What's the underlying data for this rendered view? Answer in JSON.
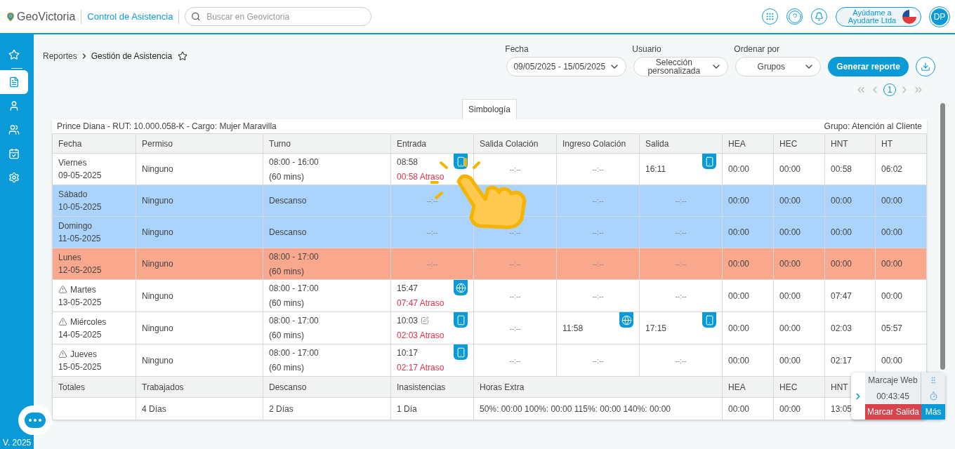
{
  "header": {
    "brand": "GeoVictoria",
    "module": "Control de Asistencia",
    "search": {
      "placeholder": "Buscar en Geovictoria"
    },
    "company": "Ayúdame a Ayudarte Ltda",
    "avatar": "DP"
  },
  "sidebar": {
    "items": [
      {
        "kind": "star",
        "selected": false
      },
      {
        "kind": "report",
        "selected": true
      },
      {
        "kind": "user",
        "selected": false
      },
      {
        "kind": "users",
        "selected": false
      },
      {
        "kind": "calendar",
        "selected": false
      },
      {
        "kind": "settings",
        "selected": false
      }
    ],
    "version": "V. 2025"
  },
  "breadcrumb": [
    "Reportes",
    "Gestión de Asistencia"
  ],
  "filters": [
    {
      "label": "Fecha",
      "value": "09/05/2025 - 15/05/2025"
    },
    {
      "label": "Usuario",
      "value": "Selección personalizada"
    },
    {
      "label": "Ordenar por",
      "value": "Grupos"
    }
  ],
  "generate_button": "Generar reporte",
  "pagination": {
    "current": "1"
  },
  "symbology_tab": "Simbología",
  "report": {
    "employee": "Prince Diana - RUT: 10.000.058-K - Cargo: Mujer Maravilla",
    "group": "Grupo: Atención al Cliente",
    "columns": [
      "Fecha",
      "Permiso",
      "Turno",
      "Entrada",
      "Salida Colación",
      "Ingreso Colación",
      "Salida",
      "HEA",
      "HEC",
      "HNT",
      "HT"
    ],
    "rows": [
      {
        "color": "#ffffff",
        "warning": false,
        "day": "Viernes",
        "date": "09-05-2025",
        "permiso": "Ninguno",
        "turno": "08:00 - 16:00",
        "turno_break": "(60 mins)",
        "entrada": {
          "time": "08:58",
          "late": "00:58 Atraso",
          "kind": "mobile",
          "edited": false
        },
        "salida_colacion": {
          "time": "--:--"
        },
        "ingreso_colacion": {
          "time": "--:--"
        },
        "salida": {
          "time": "16:11",
          "kind": "mobile"
        },
        "hea": "00:00",
        "hec": "00:00",
        "hnt": "00:58",
        "ht": "06:02"
      },
      {
        "color": "#aad4fb",
        "warning": false,
        "day": "Sábado",
        "date": "10-05-2025",
        "permiso": "Ninguno",
        "turno": "Descanso",
        "entrada": {
          "time": "--:--"
        },
        "ingreso_colacion": {
          "time": "--:--"
        },
        "salida": {
          "time": "--:--"
        },
        "hea": "00:00",
        "hec": "00:00",
        "hnt": "00:00",
        "ht": "00:00"
      },
      {
        "color": "#aad4fb",
        "warning": false,
        "day": "Domingo",
        "date": "11-05-2025",
        "permiso": "Ninguno",
        "turno": "Descanso",
        "entrada": {
          "time": "--:--"
        },
        "salida_colacion": {
          "time": "--:--"
        },
        "ingreso_colacion": {
          "time": "--:--"
        },
        "salida": {
          "time": "--:--"
        },
        "hea": "00:00",
        "hec": "00:00",
        "hnt": "00:00",
        "ht": "00:00"
      },
      {
        "color": "#f9a88e",
        "warning": false,
        "day": "Lunes",
        "date": "12-05-2025",
        "permiso": "Ninguno",
        "turno": "08:00 - 17:00",
        "turno_break": "(60 mins)",
        "entrada": {
          "time": "--:--"
        },
        "salida_colacion": {
          "time": "--:--"
        },
        "ingreso_colacion": {
          "time": "--:--"
        },
        "salida": {
          "time": "--:--"
        },
        "hea": "00:00",
        "hec": "00:00",
        "hnt": "00:00",
        "ht": "00:00"
      },
      {
        "color": "#ffffff",
        "warning": true,
        "day": "Martes",
        "date": "13-05-2025",
        "permiso": "Ninguno",
        "turno": "08:00 - 17:00",
        "turno_break": "(60 mins)",
        "entrada": {
          "time": "15:47",
          "late": "07:47 Atraso",
          "kind": "web",
          "edited": false
        },
        "salida_colacion": {
          "time": "--:--"
        },
        "ingreso_colacion": {
          "time": "--:--"
        },
        "salida": {
          "time": "--:--"
        },
        "hea": "00:00",
        "hec": "00:00",
        "hnt": "07:47",
        "ht": "00:00"
      },
      {
        "color": "#ffffff",
        "warning": true,
        "day": "Miércoles",
        "date": "14-05-2025",
        "permiso": "Ninguno",
        "turno": "08:00 - 17:00",
        "turno_break": "(60 mins)",
        "entrada": {
          "time": "10:03",
          "late": "02:03 Atraso",
          "kind": "mobile",
          "edited": true
        },
        "salida_colacion": {
          "time": "--:--"
        },
        "ingreso_colacion": {
          "time": "11:58",
          "kind": "web"
        },
        "salida": {
          "time": "17:15",
          "kind": "mobile"
        },
        "hea": "00:00",
        "hec": "00:00",
        "hnt": "02:03",
        "ht": "05:57"
      },
      {
        "color": "#ffffff",
        "warning": true,
        "day": "Jueves",
        "date": "15-05-2025",
        "permiso": "Ninguno",
        "turno": "08:00 - 17:00",
        "turno_break": "(60 mins)",
        "entrada": {
          "time": "10:17",
          "late": "02:17 Atraso",
          "kind": "mobile",
          "edited": false
        },
        "salida_colacion": {
          "time": "--:--"
        },
        "ingreso_colacion": {
          "time": "--:--"
        },
        "salida": {
          "time": "--:--"
        },
        "hea": "00:00",
        "hec": "00:00",
        "hnt": "02:17",
        "ht": "00:00"
      }
    ],
    "totals_header": [
      "Totales",
      "Trabajados",
      "Descanso",
      "Inasistencias",
      "Horas Extra",
      "HEA",
      "HEC",
      "HNT"
    ],
    "totals": [
      "4 Días",
      "2 Días",
      "1 Día",
      "50%: 00:00 100%: 00:00 115%: 00:00 140%: 00:00",
      "00:00",
      "00:00",
      "13:05"
    ]
  },
  "web_clock": {
    "title": "Marcaje Web",
    "time": "00:43:45",
    "clock_out": "Marcar Salida",
    "more": "Más"
  }
}
